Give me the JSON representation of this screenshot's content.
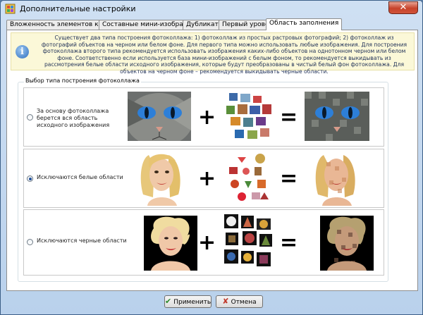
{
  "window": {
    "title": "Дополнительные настройки"
  },
  "tabs": [
    {
      "label": "Вложенность элементов коллажа"
    },
    {
      "label": "Составные мини-изображения"
    },
    {
      "label": "Дубликаты"
    },
    {
      "label": "Первый уровень"
    },
    {
      "label": "Область заполнения"
    }
  ],
  "info": {
    "text": "Существует два типа построения фотоколлажа: 1) фотоколлаж из простых растровых фотографий; 2) фотоколлаж из фотографий объектов на черном или белом фоне. Для первого типа можно использовать любые изображения. Для построения фотоколлажа второго типа рекомендуется использовать изображения каких-либо объектов на однотонном черном или белом фоне. Соответственно если используется база мини-изображений с белым фоном, то рекомендуется выкидывать из рассмотрения белые области исходного изображения, которые будут преобразованы в чистый белый фон фотоколлажа. Для объектов на черном фоне – рекомендуется выкидывать черные области."
  },
  "group": {
    "title": "Выбор типа построения фотоколлажа",
    "options": [
      {
        "label": "За основу фотоколлажа берется вся область исходного изображения",
        "selected": false
      },
      {
        "label": "Исключаются белые области",
        "selected": true
      },
      {
        "label": "Исключаются черные области",
        "selected": false
      }
    ],
    "operators": {
      "plus": "+",
      "equals": "="
    }
  },
  "buttons": {
    "apply": "Применить",
    "cancel": "Отмена"
  },
  "colors": {
    "accent": "#2f6fc0",
    "info_bg": "#fbf8d8",
    "close": "#c7432a"
  }
}
